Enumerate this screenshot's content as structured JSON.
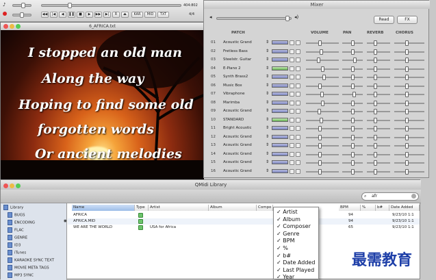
{
  "topbar": {
    "time": "404:802",
    "page": "4/4",
    "btn_rec": "R",
    "btn_eject": "⏏",
    "btn_a": "KAR",
    "btn_b": "MID",
    "btn_c": "TXT"
  },
  "karaoke": {
    "window_title": "6_AFRICA.txt",
    "lyrics": [
      "I stopped an old man",
      "Along the way",
      "Hoping to find some old",
      "forgotten words",
      "Or ancient melodies"
    ]
  },
  "mixer": {
    "title": "Mixer",
    "read_label": "Read",
    "fx_label": "FX",
    "headers": {
      "patch": "PATCH",
      "volume": "VOLUME",
      "pan": "PAN",
      "reverb": "REVERB",
      "chorus": "CHORUS"
    },
    "channels": [
      {
        "num": "01",
        "patch": "Acoustic Grand",
        "vol": 0.42,
        "pan": 0.5,
        "rev": 0.35,
        "cho": 0.4
      },
      {
        "num": "02",
        "patch": "Fretless Bass",
        "vol": 0.45,
        "pan": 0.5,
        "rev": 0.35,
        "cho": 0.4
      },
      {
        "num": "03",
        "patch": "Steelstr. Guitar",
        "vol": 0.38,
        "pan": 0.6,
        "rev": 0.35,
        "cho": 0.4
      },
      {
        "num": "04",
        "patch": "E-Piano 2",
        "vol": 0.5,
        "pan": 0.5,
        "rev": 0.35,
        "cho": 0.4
      },
      {
        "num": "05",
        "patch": "Synth Brass2",
        "vol": 0.55,
        "pan": 0.5,
        "rev": 0.35,
        "cho": 0.4
      },
      {
        "num": "06",
        "patch": "Music Box",
        "vol": 0.42,
        "pan": 0.5,
        "rev": 0.35,
        "cho": 0.4
      },
      {
        "num": "07",
        "patch": "Vibraphone",
        "vol": 0.48,
        "pan": 0.55,
        "rev": 0.35,
        "cho": 0.4
      },
      {
        "num": "08",
        "patch": "Marimba",
        "vol": 0.5,
        "pan": 0.5,
        "rev": 0.35,
        "cho": 0.4
      },
      {
        "num": "09",
        "patch": "Acoustic Grand",
        "vol": 0.4,
        "pan": 0.5,
        "rev": 0.35,
        "cho": 0.4
      },
      {
        "num": "10",
        "patch": "STANDARD",
        "vol": 0.45,
        "pan": 0.5,
        "rev": 0.35,
        "cho": 0.4
      },
      {
        "num": "11",
        "patch": "Bright Acoustic",
        "vol": 0.42,
        "pan": 0.5,
        "rev": 0.35,
        "cho": 0.4
      },
      {
        "num": "12",
        "patch": "Acoustic Grand",
        "vol": 0.42,
        "pan": 0.5,
        "rev": 0.35,
        "cho": 0.4
      },
      {
        "num": "13",
        "patch": "Acoustic Grand",
        "vol": 0.42,
        "pan": 0.5,
        "rev": 0.35,
        "cho": 0.4
      },
      {
        "num": "14",
        "patch": "Acoustic Grand",
        "vol": 0.42,
        "pan": 0.5,
        "rev": 0.35,
        "cho": 0.4
      },
      {
        "num": "15",
        "patch": "Acoustic Grand",
        "vol": 0.42,
        "pan": 0.5,
        "rev": 0.35,
        "cho": 0.4
      },
      {
        "num": "16",
        "patch": "Acoustic Grand",
        "vol": 0.42,
        "pan": 0.5,
        "rev": 0.35,
        "cho": 0.4
      }
    ]
  },
  "library": {
    "title": "QMidi Library",
    "search": "afr",
    "sidebar": [
      "Library",
      "BUGS",
      "ENCODING",
      "FLAC",
      "GENRE",
      "ID3",
      "iTunes",
      "KARAOKE SYNC TEXT",
      "MOVIE META TAGS",
      "MP3 SYNC"
    ],
    "columns": [
      "Name",
      "Type",
      "Artist",
      "Album",
      "Compo",
      "BPM",
      "%",
      "b#",
      "Date Added"
    ],
    "rows": [
      {
        "name": "AFRICA",
        "artist": "",
        "bpm": "94",
        "date": "9/23/10 1:1"
      },
      {
        "name": "AFRICA.MID",
        "artist": "",
        "bpm": "94",
        "date": "9/23/10 1:1"
      },
      {
        "name": "WE ARE THE WORLD",
        "artist": "USA for Africa",
        "bpm": "65",
        "date": "9/23/10 1:1"
      }
    ],
    "menu": [
      "Artist",
      "Album",
      "Composer",
      "Genre",
      "BPM",
      "%",
      "b#",
      "Date Added",
      "Last Played",
      "Year"
    ]
  },
  "watermark": "最需教育"
}
